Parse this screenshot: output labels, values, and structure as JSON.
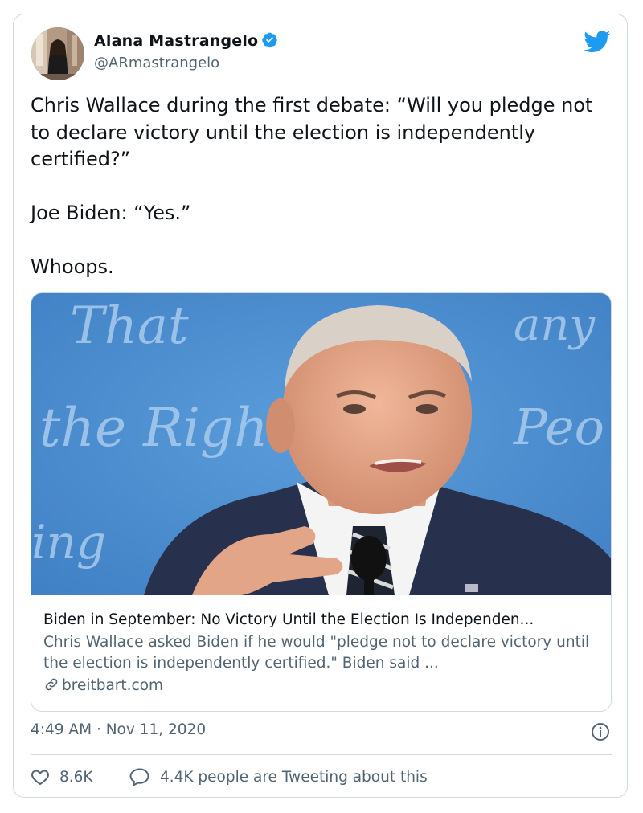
{
  "author": {
    "name": "Alana Mastrangelo",
    "handle": "@ARmastrangelo",
    "verified": true
  },
  "tweet": {
    "text": "Chris Wallace during the first debate: “Will you pledge not to declare victory until the election is independently certified?”\n\nJoe Biden: “Yes.”\n\nWhoops."
  },
  "link_card": {
    "image_text_top": "That",
    "image_text_mid": "the Right",
    "image_text_right_top": "any",
    "image_text_right_mid": "Peo",
    "image_text_bottom": "ing",
    "title": "Biden in September: No Victory Until the Election Is Independen...",
    "description": "Chris Wallace asked Biden if he would \"pledge not to declare victory until the election is independently certified.\" Biden said ...",
    "domain": "breitbart.com"
  },
  "meta": {
    "time": "4:49 AM",
    "separator": "·",
    "date": "Nov 11, 2020"
  },
  "stats": {
    "likes": "8.6K",
    "talking": "4.4K people are Tweeting about this"
  },
  "colors": {
    "twitter_blue": "#1d9bf0",
    "secondary_text": "#536471",
    "border": "#cfd9de"
  },
  "icons": [
    "verified-badge-icon",
    "twitter-bird-icon",
    "link-icon",
    "info-icon",
    "heart-icon",
    "reply-bubble-icon"
  ]
}
